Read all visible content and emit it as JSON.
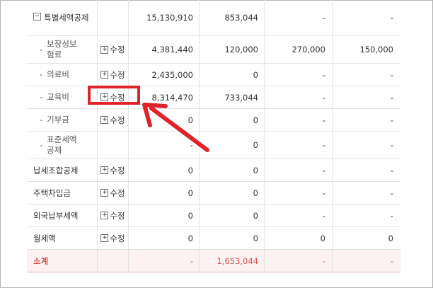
{
  "rows": [
    {
      "name": "특별세액공제",
      "edit": "",
      "v1": "15,130,910",
      "v2": "853,044",
      "v3": "-",
      "v4": "-"
    },
    {
      "name_lines": [
        "보장성보",
        "험료"
      ],
      "edit": "수정",
      "v1": "4,381,440",
      "v2": "120,000",
      "v3": "270,000",
      "v4": "150,000"
    },
    {
      "name": "의료비",
      "edit": "수정",
      "v1": "2,435,000",
      "v2": "0",
      "v3": "-",
      "v4": "-"
    },
    {
      "name": "교육비",
      "edit": "수정",
      "v1": "8,314,470",
      "v2": "733,044",
      "v3": "-",
      "v4": "-"
    },
    {
      "name": "기부금",
      "edit": "수정",
      "v1": "0",
      "v2": "0",
      "v3": "-",
      "v4": "-"
    },
    {
      "name_lines": [
        "표준세액",
        "공제"
      ],
      "edit": "",
      "v1": "-",
      "v2": "0",
      "v3": "-",
      "v4": "-"
    },
    {
      "name": "납세조합공제",
      "edit": "수정",
      "v1": "0",
      "v2": "0",
      "v3": "-",
      "v4": "-"
    },
    {
      "name": "주택차입금",
      "edit": "수정",
      "v1": "0",
      "v2": "0",
      "v3": "-",
      "v4": "-"
    },
    {
      "name": "외국납부세액",
      "edit": "수정",
      "v1": "0",
      "v2": "0",
      "v3": "-",
      "v4": "-"
    },
    {
      "name": "월세액",
      "edit": "수정",
      "v1": "0",
      "v2": "0",
      "v3": "0",
      "v4": "0"
    }
  ],
  "total": {
    "name": "소계",
    "v1": "-",
    "v2": "1,653,044",
    "v3": "-",
    "v4": "-"
  },
  "icons": {
    "expand": "minus-box-icon",
    "edit": "plus-box-icon",
    "arrow": "arrow-icon"
  },
  "colors": {
    "highlight": "#e0222a",
    "total_text": "#d9534f",
    "total_bg": "#fdf2f2"
  }
}
